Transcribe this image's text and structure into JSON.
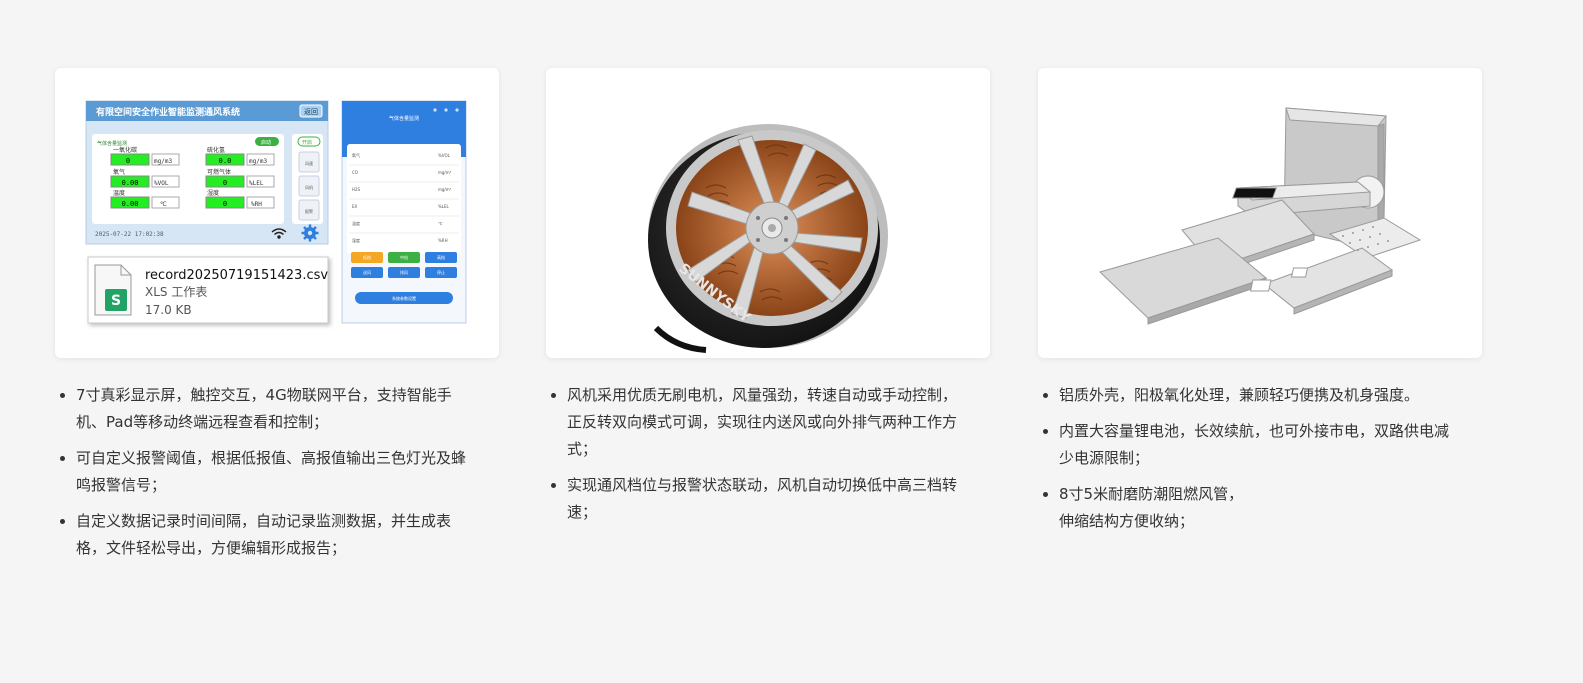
{
  "cards": [
    {
      "name": "monitoring-system-card",
      "screen": {
        "title": "有限空间安全作业智能监测通风系统",
        "exit_label": "返回",
        "section_label": "气体含量监测",
        "gases": [
          {
            "label": "一氧化碳",
            "value": "0",
            "unit": "mg/m3"
          },
          {
            "label": "硫化氢",
            "value": "0.0",
            "unit": "mg/m3"
          },
          {
            "label": "氧气",
            "value": "0.00",
            "unit": "%VOL"
          },
          {
            "label": "可燃气体",
            "value": "0",
            "unit": "%LEL"
          },
          {
            "label": "温度",
            "value": "0.00",
            "unit": "℃"
          },
          {
            "label": "湿度",
            "value": "0",
            "unit": "%RH"
          }
        ],
        "timestamp": "2025-07-22 17:02:38",
        "toggle_label": "开启",
        "toggle2_label": "启动",
        "side_btns": [
          "风速",
          "风机",
          "报警"
        ]
      },
      "file": {
        "name": "record20250719151423.csv",
        "type": "XLS 工作表",
        "size": "17.0 KB",
        "icon_letter": "S"
      },
      "phone": {
        "title": "气体含量监测",
        "rows": [
          {
            "label": "氧气",
            "unit": "%VOL"
          },
          {
            "label": "CO",
            "unit": "mg/m³"
          },
          {
            "label": "H2S",
            "unit": "mg/m³"
          },
          {
            "label": "EX",
            "unit": "%LEL"
          },
          {
            "label": "温度",
            "unit": "℃"
          },
          {
            "label": "湿度",
            "unit": "%RH"
          }
        ],
        "buttons_row1": [
          "低档",
          "中档",
          "高档"
        ],
        "buttons_row2": [
          "送风",
          "排风",
          "停止"
        ],
        "bottom_button": "系统参数设置"
      }
    },
    {
      "name": "brushless-motor-card",
      "image_text": "SUNNYSKY"
    },
    {
      "name": "aluminium-case-card"
    }
  ],
  "lists": [
    [
      "7寸真彩显示屏，触控交互，4G物联网平台，支持智能手\n机、Pad等移动终端远程查看和控制；",
      "可自定义报警阈值，根据低报值、高报值输出三色灯光及蜂\n鸣报警信号；",
      "自定义数据记录时间间隔，自动记录监测数据，并生成表\n格，文件轻松导出，方便编辑形成报告；"
    ],
    [
      "风机采用优质无刷电机，风量强劲，转速自动或手动控制，\n正反转双向模式可调，实现往内送风或向外排气两种工作方\n式；",
      "实现通风档位与报警状态联动，风机自动切换低中高三档转\n速；"
    ],
    [
      "铝质外壳，阳极氧化处理，兼顾轻巧便携及机身强度。",
      "内置大容量锂电池，长效续航，也可外接市电，双路供电减\n少电源限制；",
      "8寸5米耐磨防潮阻燃风管，\n伸缩结构方便收纳；"
    ]
  ],
  "colors": {
    "page_bg": "#f5f5f5",
    "card_bg": "#ffffff",
    "accent_blue": "#2f7fe0",
    "screen_blue": "#5b9bd5",
    "display_green": "#22ee22",
    "copper": "#c8743a"
  }
}
